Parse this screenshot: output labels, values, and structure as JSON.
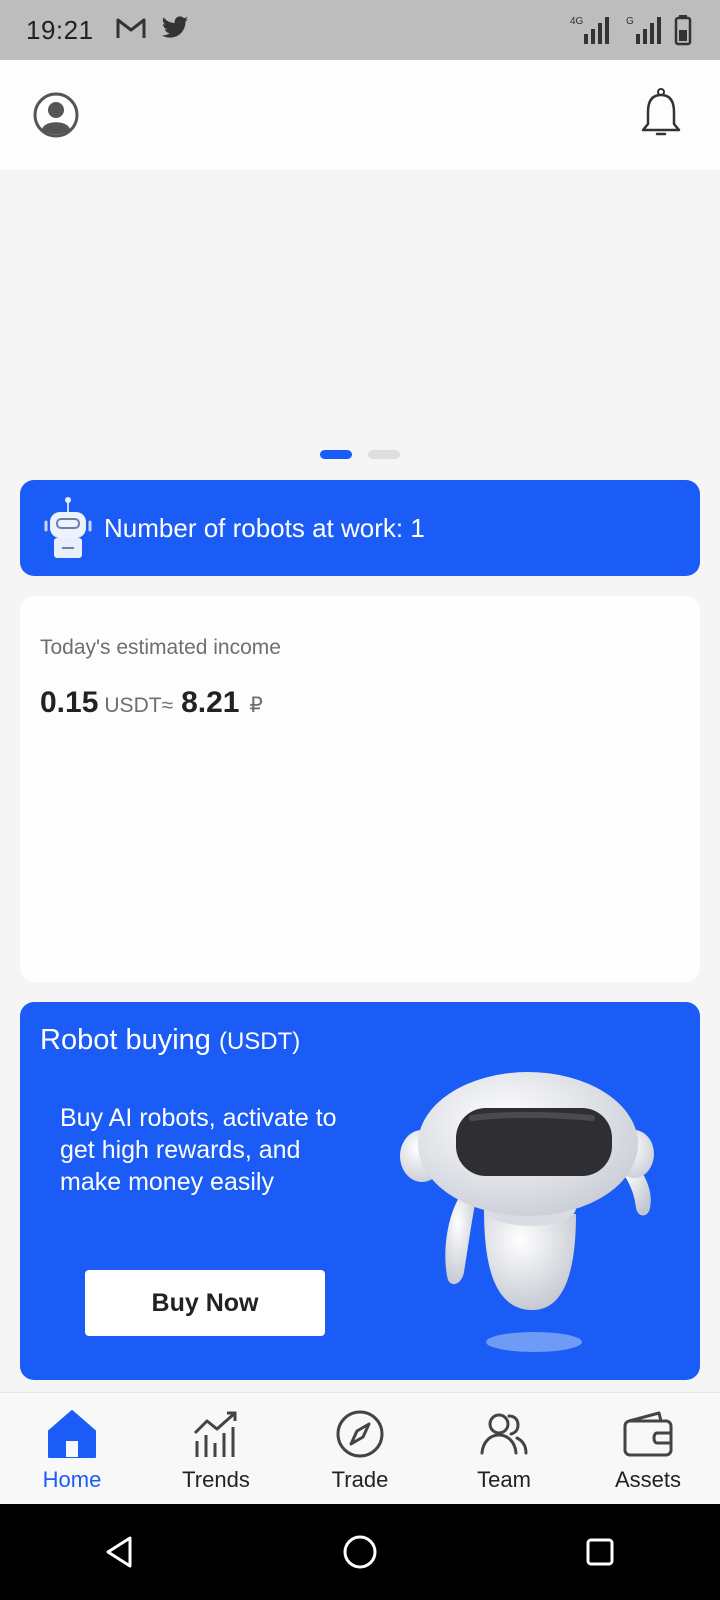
{
  "status_bar": {
    "time": "19:21",
    "left_icons": [
      "gmail-icon",
      "twitter-icon"
    ],
    "network_label_1": "4G",
    "network_label_2": "G",
    "right_icons": [
      "signal-4g-icon",
      "signal-g-icon",
      "battery-icon"
    ]
  },
  "header": {
    "left_icon": "user-avatar-icon",
    "right_icon": "bell-icon"
  },
  "banner": {
    "slides_count": 2,
    "active_slide": 1
  },
  "robots_card": {
    "text": "Number of robots at work: 1",
    "icon": "robot-icon"
  },
  "income_card": {
    "label": "Today's estimated income",
    "usdt_value": "0.15",
    "usdt_unit": "USDT",
    "approx": "≈",
    "rub_value": "8.21",
    "rub_unit": "₽"
  },
  "buy_card": {
    "title": "Robot buying",
    "title_unit": "(USDT)",
    "description": "Buy AI robots, activate to get high rewards, and make money easily",
    "button_label": "Buy Now",
    "illustration": "robot-illustration"
  },
  "bottom_nav": {
    "items": [
      {
        "label": "Home",
        "icon": "home-icon",
        "active": true
      },
      {
        "label": "Trends",
        "icon": "trends-icon",
        "active": false
      },
      {
        "label": "Trade",
        "icon": "compass-icon",
        "active": false
      },
      {
        "label": "Team",
        "icon": "team-icon",
        "active": false
      },
      {
        "label": "Assets",
        "icon": "wallet-icon",
        "active": false
      }
    ]
  },
  "system_nav": [
    "back-icon",
    "home-circle-icon",
    "recents-icon"
  ],
  "colors": {
    "accent": "#1a5cf5",
    "status_bar_bg": "#bdbdbd",
    "page_bg": "#f5f5f5",
    "card_bg": "#fdfdfd"
  }
}
